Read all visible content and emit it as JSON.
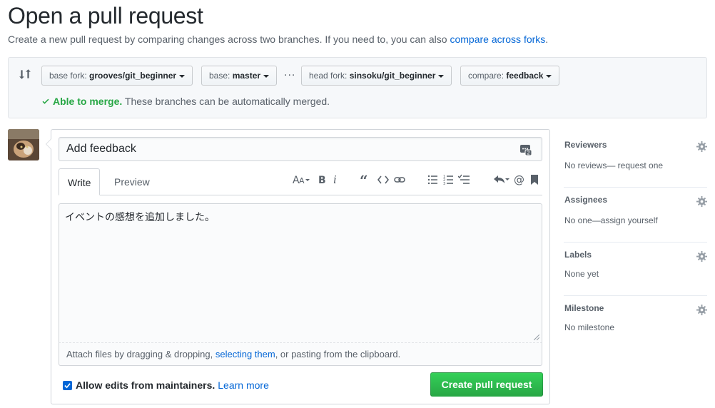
{
  "header": {
    "title": "Open a pull request",
    "subtitle_prefix": "Create a new pull request by comparing changes across two branches. If you need to, you can also ",
    "subtitle_link": "compare across forks",
    "subtitle_suffix": "."
  },
  "range": {
    "base_fork_label": "base fork:",
    "base_fork_value": "grooves/git_beginner",
    "base_label": "base:",
    "base_value": "master",
    "ellipsis": "...",
    "head_fork_label": "head fork:",
    "head_fork_value": "sinsoku/git_beginner",
    "compare_label": "compare:",
    "compare_value": "feedback",
    "merge_status_bold": "Able to merge.",
    "merge_status_text": " These branches can be automatically merged."
  },
  "form": {
    "title_value": "Add feedback",
    "tabs": [
      {
        "label": "Write"
      },
      {
        "label": "Preview"
      }
    ],
    "body_text": "イベントの感想を追加しました。",
    "attach_prefix": "Attach files by dragging & dropping, ",
    "attach_link": "selecting them",
    "attach_suffix": ", or pasting from the clipboard.",
    "allow_edits_label": "Allow edits from maintainers.",
    "learn_more": "Learn more",
    "submit_label": "Create pull request"
  },
  "sidebar": {
    "sections": [
      {
        "title": "Reviewers",
        "value": "No reviews— request one"
      },
      {
        "title": "Assignees",
        "value": "No one—assign yourself"
      },
      {
        "title": "Labels",
        "value": "None yet"
      },
      {
        "title": "Milestone",
        "value": "No milestone"
      }
    ]
  },
  "colors": {
    "accent_link": "#0366d6",
    "merge_ok": "#28a745",
    "submit_button": "#2ea44f"
  }
}
